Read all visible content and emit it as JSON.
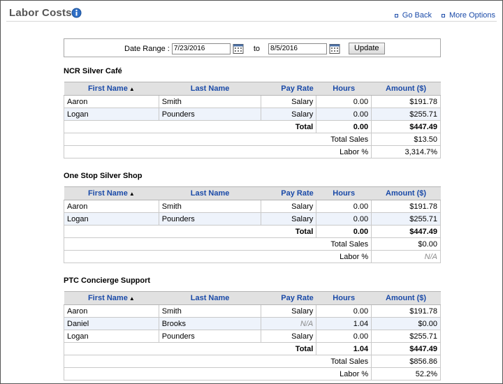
{
  "header": {
    "title": "Labor Costs",
    "go_back": "Go Back",
    "more_options": "More Options"
  },
  "filter": {
    "date_range_label": "Date Range :",
    "start_date": "7/23/2016",
    "to_label": "to",
    "end_date": "8/5/2016",
    "update_label": "Update"
  },
  "columns": {
    "first_name": "First Name",
    "last_name": "Last Name",
    "pay_rate": "Pay Rate",
    "hours": "Hours",
    "amount": "Amount ($)"
  },
  "labels": {
    "total": "Total",
    "total_sales": "Total Sales",
    "labor_pct": "Labor %"
  },
  "sections": [
    {
      "name": "NCR Silver Café",
      "rows": [
        {
          "first": "Aaron",
          "last": "Smith",
          "pay_rate": "Salary",
          "hours": "0.00",
          "amount": "$191.78"
        },
        {
          "first": "Logan",
          "last": "Pounders",
          "pay_rate": "Salary",
          "hours": "0.00",
          "amount": "$255.71"
        }
      ],
      "total_hours": "0.00",
      "total_amount": "$447.49",
      "total_sales": "$13.50",
      "labor_pct": "3,314.7%"
    },
    {
      "name": "One Stop Silver Shop",
      "rows": [
        {
          "first": "Aaron",
          "last": "Smith",
          "pay_rate": "Salary",
          "hours": "0.00",
          "amount": "$191.78"
        },
        {
          "first": "Logan",
          "last": "Pounders",
          "pay_rate": "Salary",
          "hours": "0.00",
          "amount": "$255.71"
        }
      ],
      "total_hours": "0.00",
      "total_amount": "$447.49",
      "total_sales": "$0.00",
      "labor_pct": "N/A"
    },
    {
      "name": "PTC Concierge Support",
      "rows": [
        {
          "first": "Aaron",
          "last": "Smith",
          "pay_rate": "Salary",
          "hours": "0.00",
          "amount": "$191.78"
        },
        {
          "first": "Daniel",
          "last": "Brooks",
          "pay_rate": "N/A",
          "hours": "1.04",
          "amount": "$0.00"
        },
        {
          "first": "Logan",
          "last": "Pounders",
          "pay_rate": "Salary",
          "hours": "0.00",
          "amount": "$255.71"
        }
      ],
      "total_hours": "1.04",
      "total_amount": "$447.49",
      "total_sales": "$856.86",
      "labor_pct": "52.2%"
    }
  ]
}
